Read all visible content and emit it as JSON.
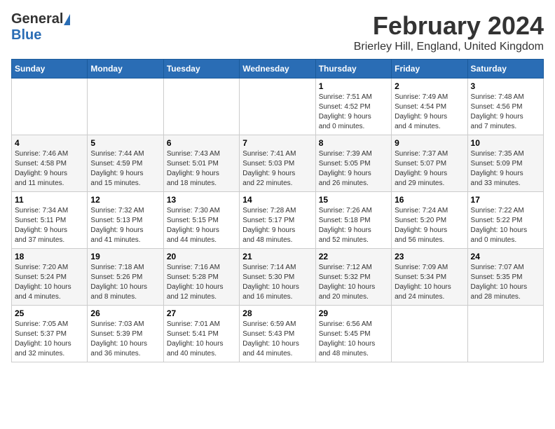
{
  "header": {
    "logo_general": "General",
    "logo_blue": "Blue",
    "month_title": "February 2024",
    "location": "Brierley Hill, England, United Kingdom"
  },
  "weekdays": [
    "Sunday",
    "Monday",
    "Tuesday",
    "Wednesday",
    "Thursday",
    "Friday",
    "Saturday"
  ],
  "weeks": [
    [
      {
        "day": "",
        "info": ""
      },
      {
        "day": "",
        "info": ""
      },
      {
        "day": "",
        "info": ""
      },
      {
        "day": "",
        "info": ""
      },
      {
        "day": "1",
        "info": "Sunrise: 7:51 AM\nSunset: 4:52 PM\nDaylight: 9 hours\nand 0 minutes."
      },
      {
        "day": "2",
        "info": "Sunrise: 7:49 AM\nSunset: 4:54 PM\nDaylight: 9 hours\nand 4 minutes."
      },
      {
        "day": "3",
        "info": "Sunrise: 7:48 AM\nSunset: 4:56 PM\nDaylight: 9 hours\nand 7 minutes."
      }
    ],
    [
      {
        "day": "4",
        "info": "Sunrise: 7:46 AM\nSunset: 4:58 PM\nDaylight: 9 hours\nand 11 minutes."
      },
      {
        "day": "5",
        "info": "Sunrise: 7:44 AM\nSunset: 4:59 PM\nDaylight: 9 hours\nand 15 minutes."
      },
      {
        "day": "6",
        "info": "Sunrise: 7:43 AM\nSunset: 5:01 PM\nDaylight: 9 hours\nand 18 minutes."
      },
      {
        "day": "7",
        "info": "Sunrise: 7:41 AM\nSunset: 5:03 PM\nDaylight: 9 hours\nand 22 minutes."
      },
      {
        "day": "8",
        "info": "Sunrise: 7:39 AM\nSunset: 5:05 PM\nDaylight: 9 hours\nand 26 minutes."
      },
      {
        "day": "9",
        "info": "Sunrise: 7:37 AM\nSunset: 5:07 PM\nDaylight: 9 hours\nand 29 minutes."
      },
      {
        "day": "10",
        "info": "Sunrise: 7:35 AM\nSunset: 5:09 PM\nDaylight: 9 hours\nand 33 minutes."
      }
    ],
    [
      {
        "day": "11",
        "info": "Sunrise: 7:34 AM\nSunset: 5:11 PM\nDaylight: 9 hours\nand 37 minutes."
      },
      {
        "day": "12",
        "info": "Sunrise: 7:32 AM\nSunset: 5:13 PM\nDaylight: 9 hours\nand 41 minutes."
      },
      {
        "day": "13",
        "info": "Sunrise: 7:30 AM\nSunset: 5:15 PM\nDaylight: 9 hours\nand 44 minutes."
      },
      {
        "day": "14",
        "info": "Sunrise: 7:28 AM\nSunset: 5:17 PM\nDaylight: 9 hours\nand 48 minutes."
      },
      {
        "day": "15",
        "info": "Sunrise: 7:26 AM\nSunset: 5:18 PM\nDaylight: 9 hours\nand 52 minutes."
      },
      {
        "day": "16",
        "info": "Sunrise: 7:24 AM\nSunset: 5:20 PM\nDaylight: 9 hours\nand 56 minutes."
      },
      {
        "day": "17",
        "info": "Sunrise: 7:22 AM\nSunset: 5:22 PM\nDaylight: 10 hours\nand 0 minutes."
      }
    ],
    [
      {
        "day": "18",
        "info": "Sunrise: 7:20 AM\nSunset: 5:24 PM\nDaylight: 10 hours\nand 4 minutes."
      },
      {
        "day": "19",
        "info": "Sunrise: 7:18 AM\nSunset: 5:26 PM\nDaylight: 10 hours\nand 8 minutes."
      },
      {
        "day": "20",
        "info": "Sunrise: 7:16 AM\nSunset: 5:28 PM\nDaylight: 10 hours\nand 12 minutes."
      },
      {
        "day": "21",
        "info": "Sunrise: 7:14 AM\nSunset: 5:30 PM\nDaylight: 10 hours\nand 16 minutes."
      },
      {
        "day": "22",
        "info": "Sunrise: 7:12 AM\nSunset: 5:32 PM\nDaylight: 10 hours\nand 20 minutes."
      },
      {
        "day": "23",
        "info": "Sunrise: 7:09 AM\nSunset: 5:34 PM\nDaylight: 10 hours\nand 24 minutes."
      },
      {
        "day": "24",
        "info": "Sunrise: 7:07 AM\nSunset: 5:35 PM\nDaylight: 10 hours\nand 28 minutes."
      }
    ],
    [
      {
        "day": "25",
        "info": "Sunrise: 7:05 AM\nSunset: 5:37 PM\nDaylight: 10 hours\nand 32 minutes."
      },
      {
        "day": "26",
        "info": "Sunrise: 7:03 AM\nSunset: 5:39 PM\nDaylight: 10 hours\nand 36 minutes."
      },
      {
        "day": "27",
        "info": "Sunrise: 7:01 AM\nSunset: 5:41 PM\nDaylight: 10 hours\nand 40 minutes."
      },
      {
        "day": "28",
        "info": "Sunrise: 6:59 AM\nSunset: 5:43 PM\nDaylight: 10 hours\nand 44 minutes."
      },
      {
        "day": "29",
        "info": "Sunrise: 6:56 AM\nSunset: 5:45 PM\nDaylight: 10 hours\nand 48 minutes."
      },
      {
        "day": "",
        "info": ""
      },
      {
        "day": "",
        "info": ""
      }
    ]
  ]
}
